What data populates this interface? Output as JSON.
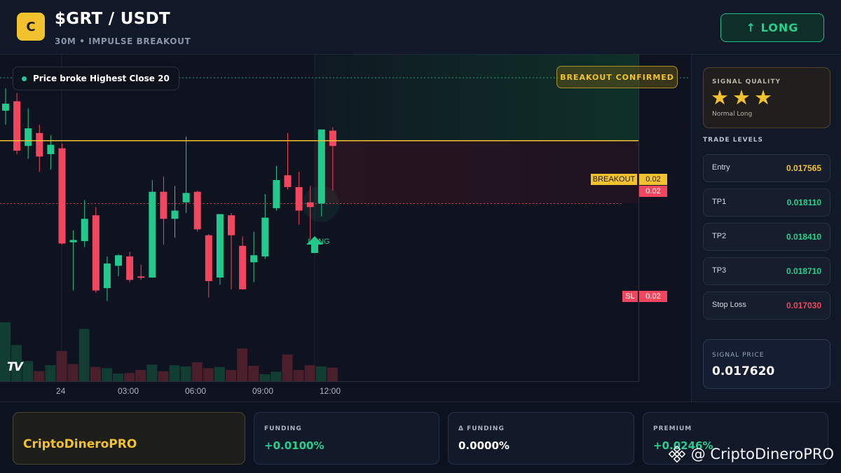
{
  "header": {
    "logo_letter": "C",
    "title": "$GRT / USDT",
    "subtitle": "30M • IMPULSE BREAKOUT",
    "direction_button": "↑ LONG"
  },
  "chart": {
    "note": "Price broke Highest Close 20",
    "breakout_badge": "BREAKOUT CONFIRMED",
    "breakout_level_label": "BREAKOUT",
    "breakout_level_value": "0.02",
    "current_price_value": "0.02",
    "sl_label": "SL",
    "sl_value": "0.02",
    "long_marker_label": "LONG",
    "tv_logo": "TV",
    "time_labels": [
      "24",
      "03:00",
      "06:00",
      "09:00",
      "12:00"
    ],
    "colors": {
      "up": "#22c98a",
      "down": "#f0475e",
      "breakout": "#f2c12e"
    }
  },
  "chart_data": {
    "type": "candlestick",
    "title": "",
    "xlabel": "",
    "ylabel": "",
    "breakout_level": 0.017565,
    "stop_loss": 0.01703,
    "candles": [
      {
        "o": 0.01782,
        "h": 0.01801,
        "l": 0.0177,
        "c": 0.01788
      },
      {
        "o": 0.0179,
        "h": 0.01797,
        "l": 0.01745,
        "c": 0.01748
      },
      {
        "o": 0.01752,
        "h": 0.01784,
        "l": 0.01741,
        "c": 0.01767
      },
      {
        "o": 0.01763,
        "h": 0.0177,
        "l": 0.0173,
        "c": 0.01743
      },
      {
        "o": 0.01745,
        "h": 0.01761,
        "l": 0.01732,
        "c": 0.01753
      },
      {
        "o": 0.0175,
        "h": 0.01754,
        "l": 0.01668,
        "c": 0.01669
      },
      {
        "o": 0.0167,
        "h": 0.0168,
        "l": 0.01629,
        "c": 0.01672
      },
      {
        "o": 0.01671,
        "h": 0.01706,
        "l": 0.01666,
        "c": 0.0169
      },
      {
        "o": 0.01693,
        "h": 0.017,
        "l": 0.01627,
        "c": 0.01629
      },
      {
        "o": 0.01631,
        "h": 0.01658,
        "l": 0.0162,
        "c": 0.01652
      },
      {
        "o": 0.0165,
        "h": 0.0166,
        "l": 0.01641,
        "c": 0.01659
      },
      {
        "o": 0.01658,
        "h": 0.01662,
        "l": 0.01636,
        "c": 0.01638
      },
      {
        "o": 0.01641,
        "h": 0.01651,
        "l": 0.01638,
        "c": 0.0164
      },
      {
        "o": 0.0164,
        "h": 0.01723,
        "l": 0.0164,
        "c": 0.01713
      },
      {
        "o": 0.01713,
        "h": 0.01726,
        "l": 0.01668,
        "c": 0.0169
      },
      {
        "o": 0.0169,
        "h": 0.01718,
        "l": 0.01674,
        "c": 0.01697
      },
      {
        "o": 0.01704,
        "h": 0.0176,
        "l": 0.01695,
        "c": 0.01712
      },
      {
        "o": 0.01713,
        "h": 0.01714,
        "l": 0.01679,
        "c": 0.01681
      },
      {
        "o": 0.01676,
        "h": 0.01677,
        "l": 0.01623,
        "c": 0.01637
      },
      {
        "o": 0.0164,
        "h": 0.01694,
        "l": 0.01634,
        "c": 0.01694
      },
      {
        "o": 0.01693,
        "h": 0.01695,
        "l": 0.0163,
        "c": 0.01676
      },
      {
        "o": 0.01667,
        "h": 0.01675,
        "l": 0.0163,
        "c": 0.0163
      },
      {
        "o": 0.01653,
        "h": 0.01679,
        "l": 0.01636,
        "c": 0.01659
      },
      {
        "o": 0.01658,
        "h": 0.01711,
        "l": 0.01656,
        "c": 0.01691
      },
      {
        "o": 0.01699,
        "h": 0.01735,
        "l": 0.01697,
        "c": 0.01723
      },
      {
        "o": 0.01727,
        "h": 0.01763,
        "l": 0.01715,
        "c": 0.01717
      },
      {
        "o": 0.01717,
        "h": 0.0173,
        "l": 0.01685,
        "c": 0.01697
      },
      {
        "o": 0.01704,
        "h": 0.01718,
        "l": 0.01672,
        "c": 0.017
      },
      {
        "o": 0.01703,
        "h": 0.01766,
        "l": 0.01692,
        "c": 0.01766
      },
      {
        "o": 0.01765,
        "h": 0.01768,
        "l": 0.01714,
        "c": 0.01752
      }
    ],
    "volume": [
      {
        "v": 100,
        "dir": "up"
      },
      {
        "v": 62,
        "dir": "up"
      },
      {
        "v": 35,
        "dir": "up"
      },
      {
        "v": 18,
        "dir": "down"
      },
      {
        "v": 28,
        "dir": "up"
      },
      {
        "v": 52,
        "dir": "down"
      },
      {
        "v": 30,
        "dir": "down"
      },
      {
        "v": 89,
        "dir": "up"
      },
      {
        "v": 25,
        "dir": "down"
      },
      {
        "v": 23,
        "dir": "up"
      },
      {
        "v": 14,
        "dir": "up"
      },
      {
        "v": 15,
        "dir": "down"
      },
      {
        "v": 20,
        "dir": "down"
      },
      {
        "v": 29,
        "dir": "up"
      },
      {
        "v": 18,
        "dir": "down"
      },
      {
        "v": 28,
        "dir": "up"
      },
      {
        "v": 26,
        "dir": "up"
      },
      {
        "v": 33,
        "dir": "down"
      },
      {
        "v": 23,
        "dir": "down"
      },
      {
        "v": 25,
        "dir": "up"
      },
      {
        "v": 20,
        "dir": "down"
      },
      {
        "v": 56,
        "dir": "down"
      },
      {
        "v": 27,
        "dir": "down"
      },
      {
        "v": 13,
        "dir": "up"
      },
      {
        "v": 17,
        "dir": "up"
      },
      {
        "v": 46,
        "dir": "down"
      },
      {
        "v": 20,
        "dir": "down"
      },
      {
        "v": 28,
        "dir": "down"
      },
      {
        "v": 26,
        "dir": "up"
      },
      {
        "v": 24,
        "dir": "down"
      }
    ]
  },
  "sidebar": {
    "quality_title": "SIGNAL QUALITY",
    "stars": [
      "★",
      "★",
      "★"
    ],
    "stars_rating": 3,
    "quality_sub": "Normal Long",
    "levels_title": "TRADE LEVELS",
    "levels": [
      {
        "name": "Entry",
        "value": "0.017565",
        "color": "#f2c12e"
      },
      {
        "name": "TP1",
        "value": "0.018110",
        "color": "#25d08f"
      },
      {
        "name": "TP2",
        "value": "0.018410",
        "color": "#25d08f"
      },
      {
        "name": "TP3",
        "value": "0.018710",
        "color": "#25d08f"
      },
      {
        "name": "Stop Loss",
        "value": "0.017030",
        "color": "#f0475e"
      }
    ],
    "signal_price_title": "SIGNAL PRICE",
    "signal_price": "0.017620"
  },
  "bottom": {
    "brand": "CriptoDineroPRO",
    "funding_label": "FUNDING",
    "funding_value": "+0.0100%",
    "delta_label": "Δ FUNDING",
    "delta_value": "0.0000%",
    "premium_label": "PREMIUM",
    "premium_value": "+0.0246%",
    "watermark": "@ CriptoDineroPRO"
  }
}
